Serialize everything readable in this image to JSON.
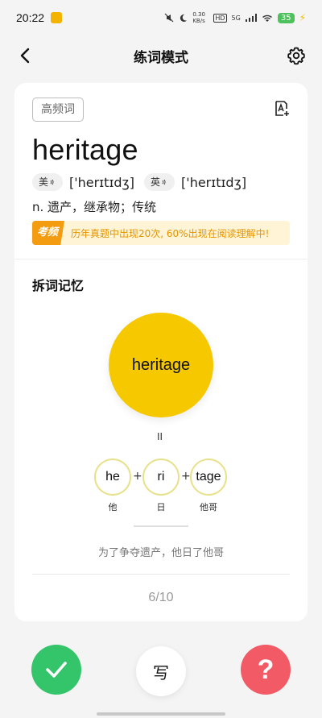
{
  "status_bar": {
    "time": "20:22",
    "net_speed": "0.30 KB/s",
    "hd": "HD",
    "signal": "5G",
    "battery": "35"
  },
  "nav": {
    "title": "练词模式",
    "back_icon": "chevron-left-icon",
    "settings_icon": "gear-icon"
  },
  "card": {
    "tag": "高频词",
    "word": "heritage",
    "us_label": "美",
    "us_phonetic": "['herɪtɪdʒ]",
    "uk_label": "英",
    "uk_phonetic": "['herɪtɪdʒ]",
    "definition": "n. 遗产，继承物；传统",
    "exam_badge": "考频",
    "exam_text": "历年真题中出现20次, 60%出现在阅读理解中!"
  },
  "split": {
    "title": "拆词记忆",
    "full_word": "heritage",
    "equals": "II",
    "parts": [
      {
        "text": "he",
        "note": "他"
      },
      {
        "text": "ri",
        "note": "日"
      },
      {
        "text": "tage",
        "note": "他哥"
      }
    ],
    "plus": "+",
    "mnemonic": "为了争夺遗产，他日了他哥"
  },
  "progress": "6/10",
  "actions": {
    "write_label": "写",
    "unknown_label": "?"
  },
  "colors": {
    "accent_yellow": "#f5c800",
    "know_green": "#34c46a",
    "unknown_red": "#f25b66",
    "exam_orange": "#f39c12"
  }
}
